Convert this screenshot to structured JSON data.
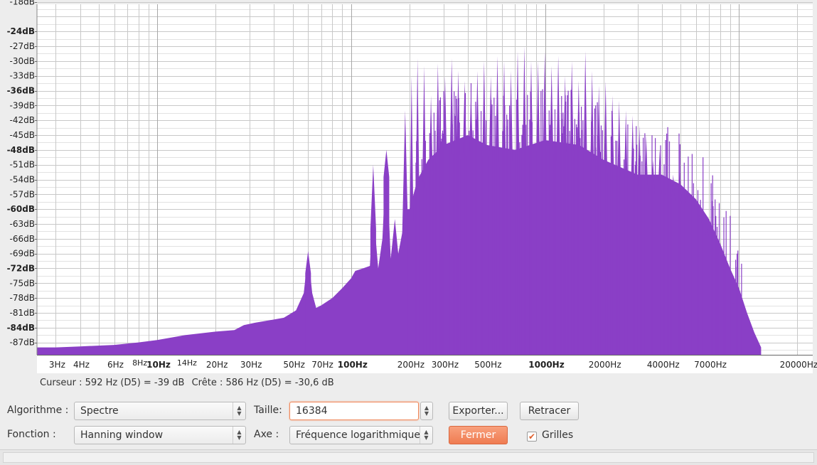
{
  "chart_data": {
    "type": "area",
    "title": "",
    "xlabel": "",
    "ylabel": "",
    "x_scale": "log",
    "xlim": [
      2.4,
      24000
    ],
    "ylim": [
      -89.5,
      -18.5
    ],
    "y_ticks": [
      {
        "v": -18,
        "label": "-18dB",
        "bold": false
      },
      {
        "v": -24,
        "label": "-24dB",
        "bold": true
      },
      {
        "v": -27,
        "label": "-27dB",
        "bold": false
      },
      {
        "v": -30,
        "label": "-30dB",
        "bold": false
      },
      {
        "v": -33,
        "label": "-33dB",
        "bold": false
      },
      {
        "v": -36,
        "label": "-36dB",
        "bold": true
      },
      {
        "v": -39,
        "label": "-39dB",
        "bold": false
      },
      {
        "v": -42,
        "label": "-42dB",
        "bold": false
      },
      {
        "v": -45,
        "label": "-45dB",
        "bold": false
      },
      {
        "v": -48,
        "label": "-48dB",
        "bold": true
      },
      {
        "v": -51,
        "label": "-51dB",
        "bold": false
      },
      {
        "v": -54,
        "label": "-54dB",
        "bold": false
      },
      {
        "v": -57,
        "label": "-57dB",
        "bold": false
      },
      {
        "v": -60,
        "label": "-60dB",
        "bold": true
      },
      {
        "v": -63,
        "label": "-63dB",
        "bold": false
      },
      {
        "v": -66,
        "label": "-66dB",
        "bold": false
      },
      {
        "v": -69,
        "label": "-69dB",
        "bold": false
      },
      {
        "v": -72,
        "label": "-72dB",
        "bold": true
      },
      {
        "v": -75,
        "label": "-75dB",
        "bold": false
      },
      {
        "v": -78,
        "label": "-78dB",
        "bold": false
      },
      {
        "v": -81,
        "label": "-81dB",
        "bold": false
      },
      {
        "v": -84,
        "label": "-84dB",
        "bold": true
      },
      {
        "v": -87,
        "label": "-87dB",
        "bold": false
      }
    ],
    "x_ticks": [
      {
        "v": 3,
        "label": "3Hz",
        "style": "normal"
      },
      {
        "v": 4,
        "label": "4Hz",
        "style": "normal"
      },
      {
        "v": 6,
        "label": "6Hz",
        "style": "normal"
      },
      {
        "v": 8,
        "label": "8Hz",
        "style": "small"
      },
      {
        "v": 10,
        "label": "10Hz",
        "style": "bold"
      },
      {
        "v": 14,
        "label": "14Hz",
        "style": "small"
      },
      {
        "v": 20,
        "label": "20Hz",
        "style": "normal"
      },
      {
        "v": 30,
        "label": "30Hz",
        "style": "normal"
      },
      {
        "v": 50,
        "label": "50Hz",
        "style": "normal"
      },
      {
        "v": 70,
        "label": "70Hz",
        "style": "normal"
      },
      {
        "v": 100,
        "label": "100Hz",
        "style": "bold"
      },
      {
        "v": 200,
        "label": "200Hz",
        "style": "normal"
      },
      {
        "v": 300,
        "label": "300Hz",
        "style": "normal"
      },
      {
        "v": 500,
        "label": "500Hz",
        "style": "normal"
      },
      {
        "v": 1000,
        "label": "1000Hz",
        "style": "bold"
      },
      {
        "v": 2000,
        "label": "2000Hz",
        "style": "normal"
      },
      {
        "v": 4000,
        "label": "4000Hz",
        "style": "normal"
      },
      {
        "v": 7000,
        "label": "7000Hz",
        "style": "normal"
      },
      {
        "v": 20000,
        "label": "20000Hz",
        "style": "normal"
      }
    ],
    "grid": true,
    "fill_color": "#8a3fc6",
    "series": [
      {
        "x": [
          2.4,
          3,
          4,
          6,
          8,
          10,
          14,
          20,
          25,
          28,
          32,
          38,
          45,
          52,
          57,
          60,
          63,
          66,
          70,
          80,
          90,
          100,
          105,
          115,
          125,
          130,
          138,
          145,
          152,
          160,
          168,
          175,
          183,
          190,
          200,
          220,
          250,
          300,
          400,
          500,
          700,
          1000,
          1500,
          2000,
          3000,
          4000,
          5000,
          6000,
          7000,
          8000,
          9000,
          10000,
          11000,
          12000,
          13000
        ],
        "y": [
          -88,
          -88,
          -87.8,
          -87.5,
          -87,
          -86.5,
          -85.5,
          -84.8,
          -84.5,
          -83.5,
          -83,
          -82.5,
          -82,
          -80.5,
          -77,
          -69,
          -77,
          -80,
          -79.5,
          -78,
          -76,
          -74,
          -72.5,
          -72,
          -71.5,
          -60,
          -72,
          -66,
          -49.5,
          -70,
          -62,
          -69,
          -65,
          -60,
          -60,
          -54,
          -50,
          -47,
          -45,
          -47,
          -48,
          -46,
          -47,
          -50,
          -53,
          -53,
          -55,
          -58,
          -62,
          -67,
          -72,
          -76,
          -81,
          -85,
          -88
        ]
      }
    ],
    "peaks": [
      {
        "x": 60,
        "y": -68.5
      },
      {
        "x": 130,
        "y": -51
      },
      {
        "x": 152,
        "y": -48
      },
      {
        "x": 190,
        "y": -40
      },
      {
        "x": 205,
        "y": -33
      },
      {
        "x": 220,
        "y": -29.5
      },
      {
        "x": 238,
        "y": -31
      },
      {
        "x": 258,
        "y": -37
      },
      {
        "x": 280,
        "y": -30.5
      },
      {
        "x": 305,
        "y": -33
      },
      {
        "x": 330,
        "y": -29.5
      },
      {
        "x": 357,
        "y": -32
      },
      {
        "x": 385,
        "y": -34
      },
      {
        "x": 415,
        "y": -36
      },
      {
        "x": 448,
        "y": -32
      },
      {
        "x": 485,
        "y": -30
      },
      {
        "x": 525,
        "y": -33
      },
      {
        "x": 568,
        "y": -29
      },
      {
        "x": 615,
        "y": -30
      },
      {
        "x": 667,
        "y": -32
      },
      {
        "x": 722,
        "y": -28
      },
      {
        "x": 782,
        "y": -27
      },
      {
        "x": 848,
        "y": -30
      },
      {
        "x": 920,
        "y": -30
      },
      {
        "x": 997,
        "y": -28
      },
      {
        "x": 1080,
        "y": -31
      },
      {
        "x": 1170,
        "y": -29
      },
      {
        "x": 1268,
        "y": -33
      },
      {
        "x": 1374,
        "y": -30
      },
      {
        "x": 1490,
        "y": -34
      },
      {
        "x": 1613,
        "y": -28
      },
      {
        "x": 1748,
        "y": -32
      },
      {
        "x": 1894,
        "y": -35
      },
      {
        "x": 2052,
        "y": -34
      },
      {
        "x": 2224,
        "y": -37
      },
      {
        "x": 2410,
        "y": -38
      },
      {
        "x": 2611,
        "y": -40
      },
      {
        "x": 2829,
        "y": -41
      },
      {
        "x": 3066,
        "y": -43
      },
      {
        "x": 3322,
        "y": -45
      },
      {
        "x": 3600,
        "y": -50
      },
      {
        "x": 3900,
        "y": -48
      },
      {
        "x": 4226,
        "y": -55
      },
      {
        "x": 4580,
        "y": -53
      },
      {
        "x": 4962,
        "y": -52
      },
      {
        "x": 5377,
        "y": -56
      },
      {
        "x": 5826,
        "y": -58
      },
      {
        "x": 6313,
        "y": -60
      },
      {
        "x": 6840,
        "y": -64
      },
      {
        "x": 7412,
        "y": -70
      },
      {
        "x": 8030,
        "y": -72
      },
      {
        "x": 8700,
        "y": -74
      },
      {
        "x": 9400,
        "y": -79
      }
    ]
  },
  "status": {
    "cursor": "Curseur : 592 Hz (D5) = -39 dB",
    "peak": "Crête : 586 Hz (D5) = -30,6 dB"
  },
  "controls": {
    "algorithm_label": "Algorithme :",
    "algorithm_value": "Spectre",
    "size_label": "Taille:",
    "size_value": "16384",
    "export_label": "Exporter...",
    "replot_label": "Retracer",
    "function_label": "Fonction :",
    "function_value": "Hanning window",
    "axis_label": "Axe :",
    "axis_value": "Fréquence logarithmique",
    "close_label": "Fermer",
    "grid_label": "Grilles",
    "grid_checked": true
  },
  "colors": {
    "accent": "#ef7c52",
    "spectrum": "#8a3fc6",
    "grid": "#c8c8c8"
  }
}
